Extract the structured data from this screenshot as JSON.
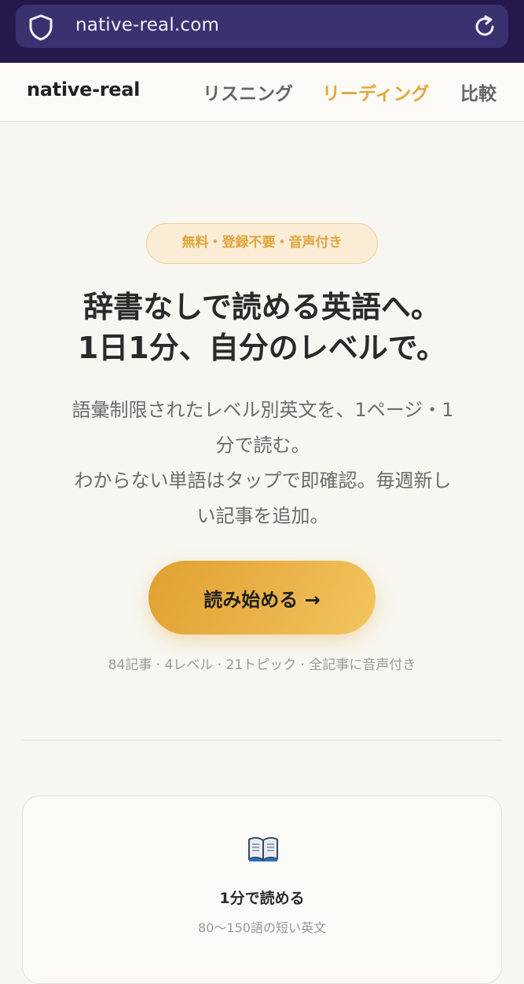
{
  "browser": {
    "url": "native-real.com"
  },
  "nav": {
    "logo": "native-real",
    "items": [
      {
        "label": "リスニング"
      },
      {
        "label": "リーディング",
        "active": true
      },
      {
        "label": "比較"
      }
    ]
  },
  "hero": {
    "badge": "無料・登録不要・音声付き",
    "title_lines": [
      "辞書なしで読める英語へ。",
      "1日1分、自分のレベルで。"
    ],
    "desc_lines": [
      "語彙制限されたレベル別英文を、1ページ・1",
      "分で読む。",
      "わからない単語はタップで即確認。毎週新し",
      "い記事を追加。"
    ],
    "cta_label": "読み始める →",
    "stats": "84記事 · 4レベル · 21トピック · 全記事に音声付き"
  },
  "features": [
    {
      "icon": "book-icon",
      "title": "1分で読める",
      "subtitle": "80〜150語の短い英文"
    }
  ],
  "colors": {
    "accent": "#e6a53a",
    "browser_bar": "#24184d",
    "background": "#f7f6f1"
  }
}
